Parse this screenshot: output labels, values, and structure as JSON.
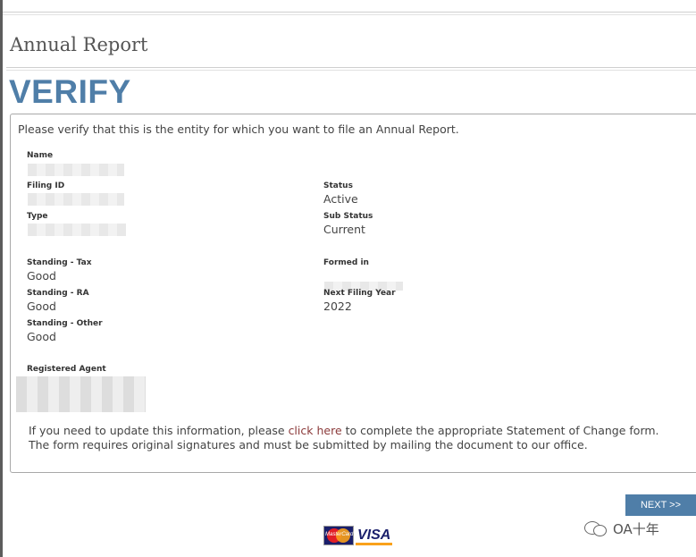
{
  "page": {
    "heading": "Annual Report",
    "verify_title": "VERIFY"
  },
  "panel": {
    "intro": "Please verify that this is the entity for which you want to file an Annual Report.",
    "fields": {
      "name": {
        "label": "Name",
        "value": ""
      },
      "filing_id": {
        "label": "Filing ID",
        "value": ""
      },
      "type": {
        "label": "Type",
        "value": ""
      },
      "status": {
        "label": "Status",
        "value": "Active"
      },
      "sub_status": {
        "label": "Sub Status",
        "value": "Current"
      },
      "standing_tax": {
        "label": "Standing - Tax",
        "value": "Good"
      },
      "standing_ra": {
        "label": "Standing - RA",
        "value": "Good"
      },
      "standing_other": {
        "label": "Standing - Other",
        "value": "Good"
      },
      "formed_in": {
        "label": "Formed in",
        "value": ""
      },
      "next_filing_year": {
        "label": "Next Filing Year",
        "value": "2022"
      },
      "registered_agent": {
        "label": "Registered Agent",
        "value": ""
      }
    },
    "update_note": {
      "before": "If you need to update this information, please ",
      "link": "click here",
      "after": " to complete the appropriate Statement of Change form.",
      "line2": "The form requires original signatures and must be submitted by mailing the document to our office."
    }
  },
  "actions": {
    "next_label": "NEXT >>"
  },
  "payment": {
    "mastercard_text": "MasterCard",
    "visa_text": "VISA"
  },
  "watermark": {
    "text": "OA十年"
  }
}
